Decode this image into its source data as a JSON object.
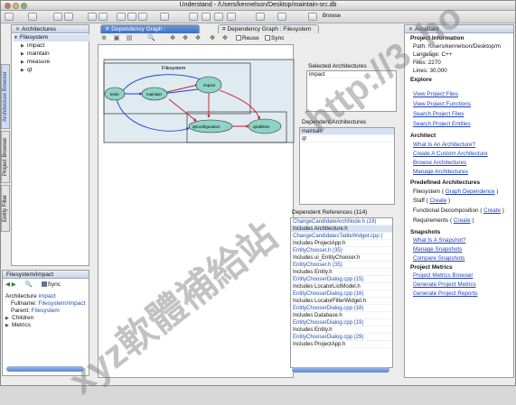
{
  "window": {
    "title": "Understand - /Users/kennelson/Desktop/maintain-src.db"
  },
  "toolbar": {
    "browse_label": "Browse"
  },
  "architectures": {
    "title": "Architectures",
    "root": "Filesystem",
    "items": [
      "impact",
      "maintain",
      "measure",
      "qt"
    ]
  },
  "vtabs": {
    "architecture_browser": "Architecture Browser",
    "project_browser": "Project Browser",
    "entity_filter": "Entity Filter"
  },
  "tabs": {
    "active": "Dependency Graph : Filesystem",
    "inactive": "Dependency Graph : Filesystem"
  },
  "graph_toolbar": {
    "reuse_label": "Reuse",
    "sync_label": "Sync"
  },
  "graph": {
    "cluster_label": "Filesystem",
    "nodes": [
      "tests",
      "maintain",
      "impact",
      "qtConfiguration",
      "qtUtilities"
    ]
  },
  "selected_arch": {
    "title": "Selected Architectures",
    "items": [
      "impact"
    ]
  },
  "dependent_arch": {
    "title": "Dependent Architectures",
    "items": [
      "maintain",
      "qt"
    ]
  },
  "dependent_refs": {
    "title": "Dependent References (114)",
    "rows": [
      {
        "text": "ChangeCandidateArchNode.h (19)",
        "kind": "file"
      },
      {
        "text": "Includes Architecture.h",
        "kind": "inc"
      },
      {
        "text": "ChangeCandidatesTableWidget.cpp (",
        "kind": "file"
      },
      {
        "text": "Includes ProjectApp.h",
        "kind": "inc"
      },
      {
        "text": "EntityChooser.h (35)",
        "kind": "file"
      },
      {
        "text": "Includes ui_EntityChooser.h",
        "kind": "inc"
      },
      {
        "text": "EntityChooser.h (35)",
        "kind": "file"
      },
      {
        "text": "Includes Entity.h",
        "kind": "inc"
      },
      {
        "text": "EntityChooserDialog.cpp (15)",
        "kind": "file"
      },
      {
        "text": "Includes LocatorListModel.h",
        "kind": "inc"
      },
      {
        "text": "EntityChooserDialog.cpp (16)",
        "kind": "file"
      },
      {
        "text": "Includes LocatorFilterWidget.h",
        "kind": "inc"
      },
      {
        "text": "EntityChooserDialog.cpp (18)",
        "kind": "file"
      },
      {
        "text": "Includes Database.h",
        "kind": "inc"
      },
      {
        "text": "EntityChooserDialog.cpp (19)",
        "kind": "file"
      },
      {
        "text": "Includes Entity.h",
        "kind": "inc"
      },
      {
        "text": "EntityChooserDialog.cpp (29)",
        "kind": "file"
      },
      {
        "text": "Includes ProjectApp.h",
        "kind": "inc"
      }
    ]
  },
  "info": {
    "title": "Filesystem/impact",
    "sync_label": "Sync",
    "architecture_label": "Architecture",
    "architecture_value": "impact",
    "fullname_label": "Fullname:",
    "fullname_value": "Filesystem/impact",
    "parent_label": "Parent:",
    "parent_value": "Filesystem",
    "children_label": "Children",
    "metrics_label": "Metrics"
  },
  "assistant": {
    "title": "Assistant",
    "project_info": {
      "heading": "Project Information",
      "path": "Path: /Users/kennelson/Desktop/m",
      "language": "Language: C++",
      "files": "Files: 2270",
      "lines": "Lines: 30,000"
    },
    "explore": {
      "heading": "Explore",
      "links": [
        "View Project Files",
        "View Project Functions",
        "Search Project Files",
        "Search Project Entities"
      ]
    },
    "architect": {
      "heading": "Architect",
      "links": [
        "What Is An Architecture?",
        "Create A Custom Architecture",
        "Browse Architectures",
        "Manage Architectures"
      ]
    },
    "predefined": {
      "heading": "Predefined Architectures",
      "filesystem": "Filesystem",
      "filesystem_link": "Graph Dependence",
      "staff": "Staff",
      "staff_link": "Create",
      "functional": "Functional Decomposition",
      "functional_link": "Create",
      "requirements": "Requirements",
      "requirements_link": "Create"
    },
    "snapshots": {
      "heading": "Snapshots",
      "links": [
        "What Is A Snapshot?",
        "Manage Snapshots",
        "Compare Snapshots"
      ]
    },
    "metrics": {
      "heading": "Project Metrics",
      "links": [
        "Project Metrics Browser",
        "Generate Project Metrics",
        "Generate Project Reports"
      ]
    }
  },
  "watermark": {
    "cjk": "xyz軟體補給站",
    "url": "http://3_ho"
  },
  "colors": {
    "graph_node": "#8fd3c6",
    "edge_red": "#cc1a1a",
    "edge_blue": "#1a3fcc",
    "link": "#1f3fc0",
    "tab_active": "#4f7fca"
  }
}
